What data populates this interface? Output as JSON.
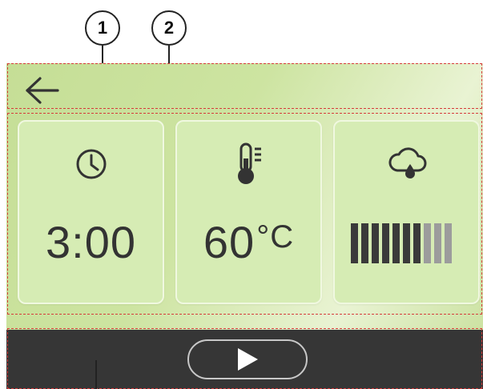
{
  "callouts": [
    {
      "number": "1"
    },
    {
      "number": "2"
    }
  ],
  "header": {
    "back_icon": "arrow-left-icon"
  },
  "cards": [
    {
      "icon": "clock-icon",
      "value": "3:00",
      "unit": ""
    },
    {
      "icon": "thermometer-icon",
      "value": "60",
      "unit": "°C"
    },
    {
      "icon": "steam-cloud-icon",
      "level": 0.7,
      "segments_total": 10,
      "segments_on": 7
    }
  ],
  "bottom_bar": {
    "play_icon": "play-icon"
  },
  "colors": {
    "screen": "#cde4a1",
    "card": "#d6ecb4",
    "bottom_bar": "#363636",
    "zone_outline": "#d63b3b",
    "meter_on": "#3a3a3a",
    "meter_off": "#9c9c9c"
  }
}
